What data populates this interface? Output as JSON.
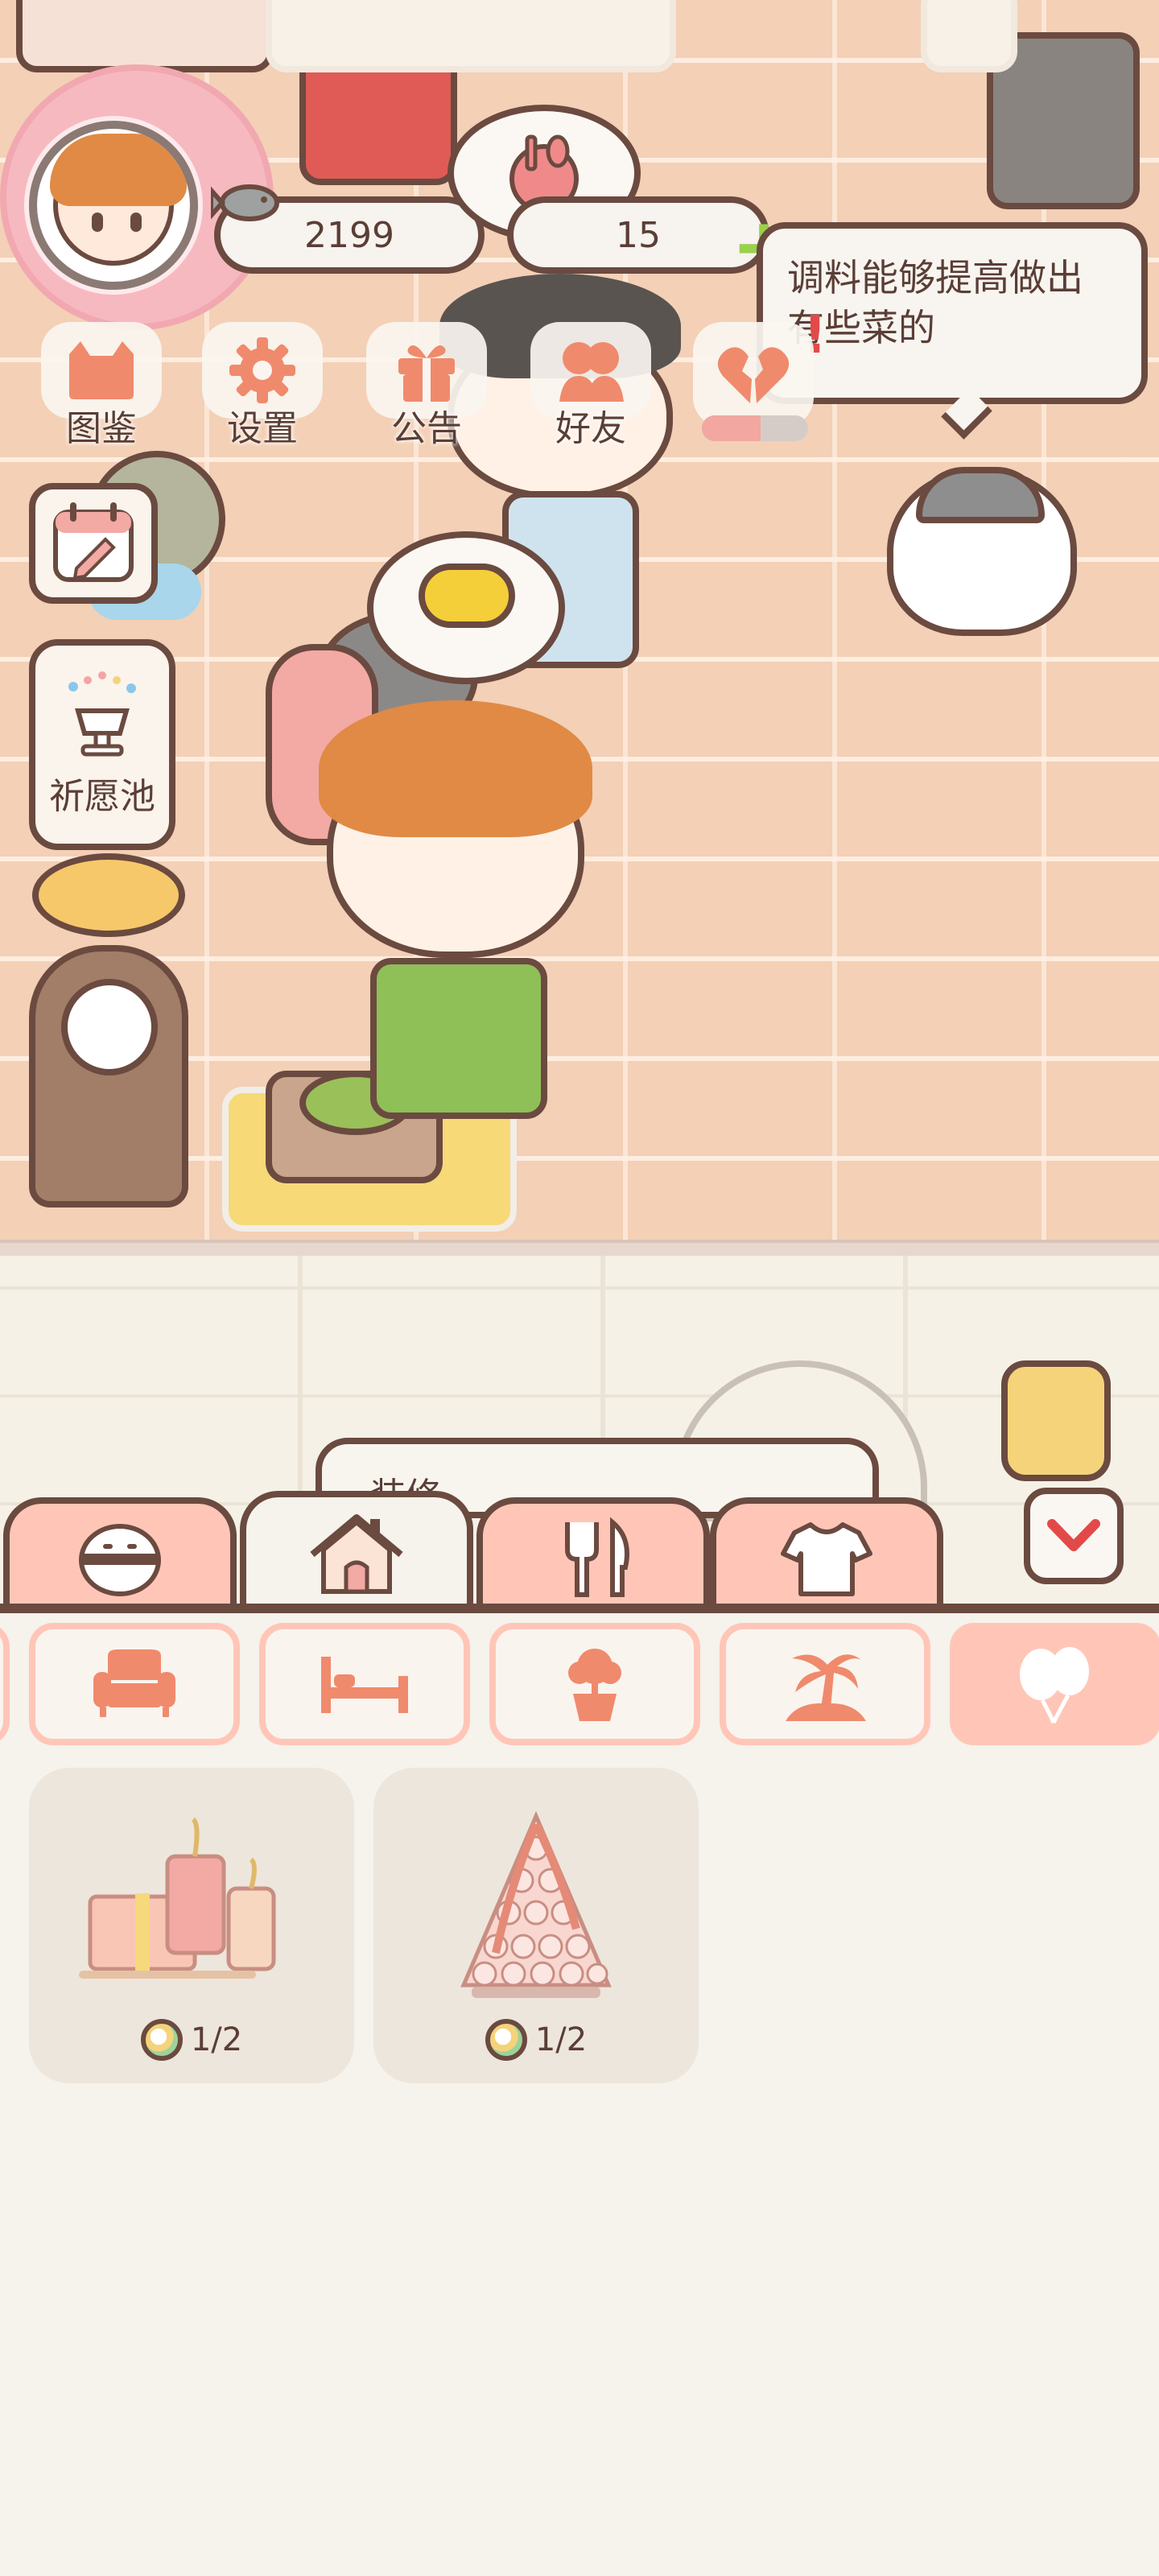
{
  "hud": {
    "coins": "2199",
    "hearts": "15",
    "plus_label": "+"
  },
  "speech": {
    "text": "调料能够提高做出有些菜的"
  },
  "menu": [
    {
      "label": "图鉴",
      "icon": "cat-book-icon"
    },
    {
      "label": "设置",
      "icon": "gear-icon"
    },
    {
      "label": "公告",
      "icon": "gift-icon"
    },
    {
      "label": "好友",
      "icon": "friends-icon"
    },
    {
      "label": "",
      "icon": "broken-heart-icon"
    }
  ],
  "energy_fraction": 0.55,
  "side": {
    "wish_label": "祈愿池"
  },
  "shop": {
    "counter_text": "装修"
  },
  "tabs": [
    {
      "icon": "rice-ball-icon",
      "active": false
    },
    {
      "icon": "house-icon",
      "active": true
    },
    {
      "icon": "fork-knife-icon",
      "active": false
    },
    {
      "icon": "shirt-icon",
      "active": false
    }
  ],
  "subcategories": [
    {
      "icon": "sofa-icon"
    },
    {
      "icon": "bed-icon"
    },
    {
      "icon": "flower-pot-icon"
    },
    {
      "icon": "palm-island-icon"
    },
    {
      "icon": "balloons-icon",
      "active": true
    }
  ],
  "items": [
    {
      "name": "gift-and-candles",
      "count": "1/2"
    },
    {
      "name": "macaron-tower",
      "count": "1/2"
    }
  ],
  "colors": {
    "accent_pink": "#ffc6b8",
    "icon_orange": "#f08a6c",
    "outline": "#6b4a40",
    "scene_wall": "#f3d0b6",
    "background": "#f6f2ec"
  }
}
